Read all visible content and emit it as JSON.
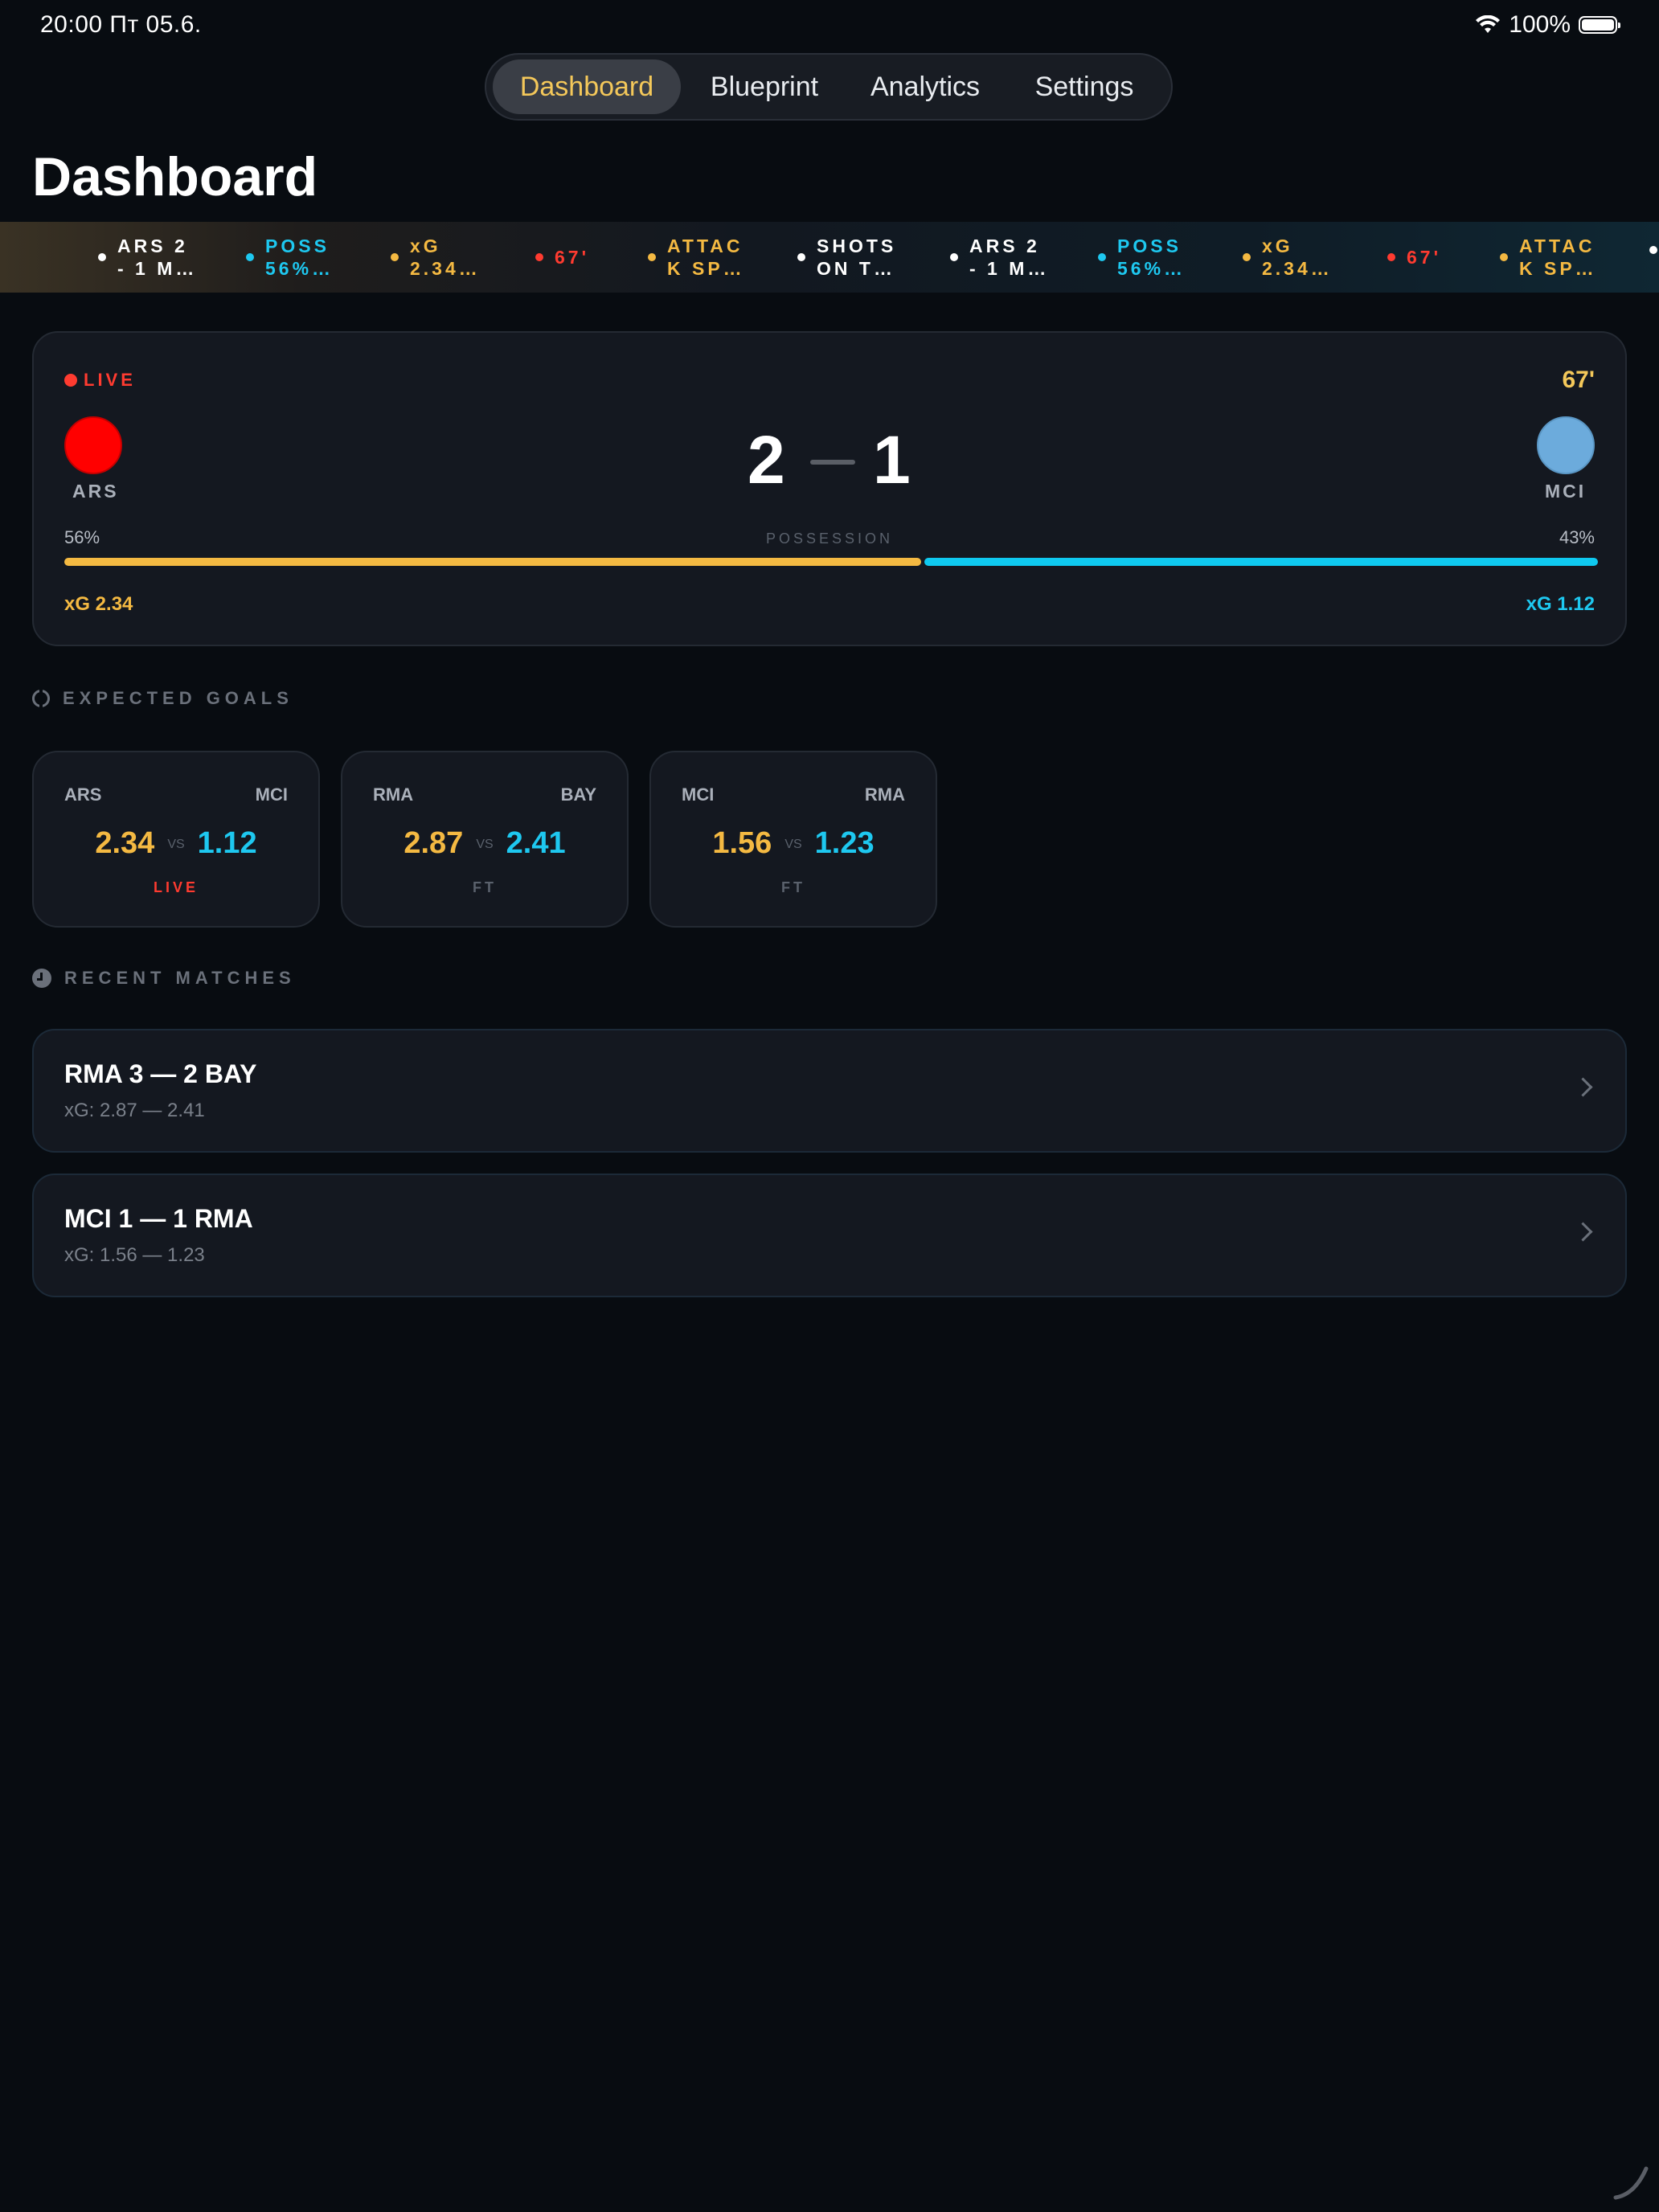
{
  "status_bar": {
    "time": "20:00  Пт 05.6.",
    "battery": "100%"
  },
  "nav": {
    "tabs": [
      "Dashboard",
      "Blueprint",
      "Analytics",
      "Settings"
    ],
    "active": "Dashboard"
  },
  "page_title": "Dashboard",
  "ticker": {
    "items": [
      {
        "text": "ARS 2 - 1 M…",
        "color": "#ffffff"
      },
      {
        "text": "POSS 56%…",
        "color": "#1ec8f0"
      },
      {
        "text": "xG 2.34…",
        "color": "#f4b942"
      },
      {
        "text": "67'",
        "color": "#ff3b30"
      },
      {
        "text": "ATTAC K SP…",
        "color": "#f4b942"
      },
      {
        "text": "SHOTS ON T…",
        "color": "#ffffff"
      },
      {
        "text": "ARS 2 - 1 M…",
        "color": "#ffffff"
      },
      {
        "text": "POSS 56%…",
        "color": "#1ec8f0"
      },
      {
        "text": "xG 2.34…",
        "color": "#f4b942"
      },
      {
        "text": "67'",
        "color": "#ff3b30"
      },
      {
        "text": "ATTAC K SP…",
        "color": "#f4b942"
      }
    ]
  },
  "live_match": {
    "status": "LIVE",
    "minute": "67'",
    "home": {
      "code": "ARS",
      "score": "2",
      "color": "#ff0000",
      "possession": "56%",
      "xg": "xG 2.34"
    },
    "away": {
      "code": "MCI",
      "score": "1",
      "color": "#6cabdc",
      "possession": "43%",
      "xg": "xG 1.12"
    },
    "possession_label": "POSSESSION",
    "possession_home_fraction": 0.56
  },
  "expected_goals": {
    "heading": "EXPECTED GOALS",
    "cards": [
      {
        "home": "ARS",
        "away": "MCI",
        "home_xg": "2.34",
        "away_xg": "1.12",
        "vs": "VS",
        "status": "LIVE",
        "status_color": "#ff3b30"
      },
      {
        "home": "RMA",
        "away": "BAY",
        "home_xg": "2.87",
        "away_xg": "2.41",
        "vs": "VS",
        "status": "FT",
        "status_color": "#5a616c"
      },
      {
        "home": "MCI",
        "away": "RMA",
        "home_xg": "1.56",
        "away_xg": "1.23",
        "vs": "VS",
        "status": "FT",
        "status_color": "#5a616c"
      }
    ]
  },
  "recent_matches": {
    "heading": "RECENT MATCHES",
    "items": [
      {
        "title": "RMA 3 — 2 BAY",
        "subtitle": "xG: 2.87 — 2.41"
      },
      {
        "title": "MCI 1 — 1 RMA",
        "subtitle": "xG: 1.56 — 1.23"
      }
    ]
  },
  "colors": {
    "accent_home": "#f4b942",
    "accent_away": "#1ec8f0",
    "live": "#ff3b30",
    "background": "#080c11"
  }
}
